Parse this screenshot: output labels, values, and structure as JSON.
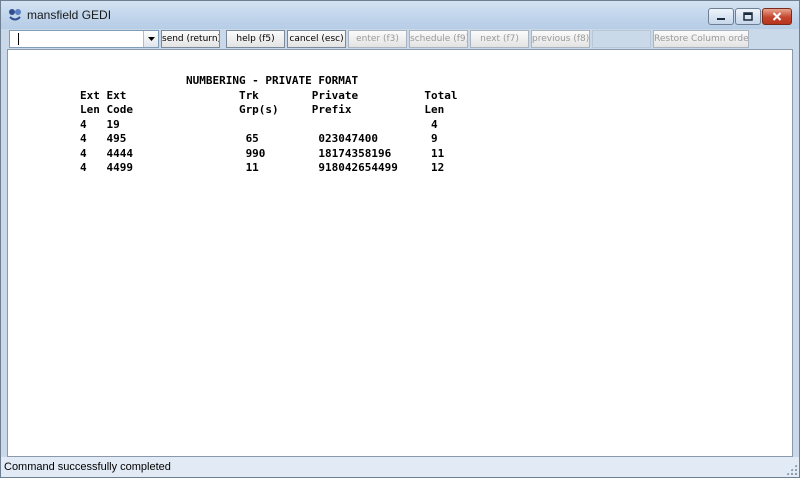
{
  "window": {
    "title": "mansfield GEDI",
    "icon": "app-logo-icon",
    "controls": {
      "minimize": "minimize-icon",
      "maximize": "maximize-icon",
      "close": "close-icon"
    }
  },
  "toolbar": {
    "combo_value": "",
    "send_label": "send (return)",
    "help_label": "help (f5)",
    "cancel_label": "cancel (esc)",
    "enter_label": "enter (f3)",
    "schedule_label": "schedule (f9)",
    "next_label": "next (f7)",
    "previous_label": "previous (f8)",
    "restore_label": "Restore Column order"
  },
  "terminal": {
    "lines": [
      "                NUMBERING - PRIVATE FORMAT",
      "Ext Ext                 Trk        Private          Total",
      "Len Code                Grp(s)     Prefix           Len",
      "4   19                                               4",
      "4   495                  65         023047400        9",
      "4   4444                 990        18174358196      11",
      "4   4499                 11         918042654499     12"
    ]
  },
  "status": {
    "message": "Command successfully completed"
  }
}
